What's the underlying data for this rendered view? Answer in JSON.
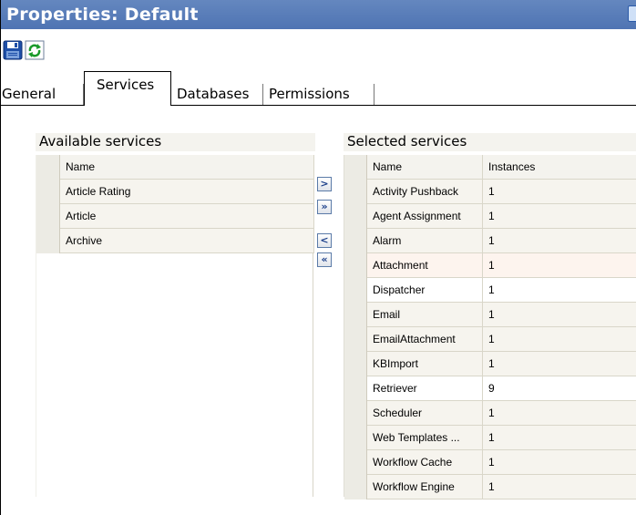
{
  "window": {
    "title": "Properties: Default"
  },
  "toolbar": {
    "save_icon": "save-disk-icon",
    "refresh_icon": "refresh-icon"
  },
  "tabs": [
    {
      "label": "General",
      "selected": false
    },
    {
      "label": "Services",
      "selected": true
    },
    {
      "label": "Databases",
      "selected": false
    },
    {
      "label": "Permissions",
      "selected": false
    }
  ],
  "available": {
    "label": "Available services",
    "columns": [
      "Name"
    ],
    "rows": [
      "Article Rating",
      "Article",
      "Archive"
    ]
  },
  "transfer": {
    "add": ">",
    "add_all": "»",
    "remove": "<",
    "remove_all": "«"
  },
  "selected": {
    "label": "Selected services",
    "columns": [
      "Name",
      "Instances"
    ],
    "rows": [
      {
        "name": "Activity Pushback",
        "instances": "1"
      },
      {
        "name": "Agent Assignment",
        "instances": "1"
      },
      {
        "name": "Alarm",
        "instances": "1"
      },
      {
        "name": "Attachment",
        "instances": "1"
      },
      {
        "name": "Dispatcher",
        "instances": "1"
      },
      {
        "name": "Email",
        "instances": "1"
      },
      {
        "name": "EmailAttachment",
        "instances": "1"
      },
      {
        "name": "KBImport",
        "instances": "1"
      },
      {
        "name": "Retriever",
        "instances": "9"
      },
      {
        "name": "Scheduler",
        "instances": "1"
      },
      {
        "name": "Web Templates ...",
        "instances": "1"
      },
      {
        "name": "Workflow Cache",
        "instances": "1"
      },
      {
        "name": "Workflow Engine",
        "instances": "1"
      }
    ]
  },
  "colors": {
    "titlebar": "#4f74b3",
    "grid_header": "#f4f3ee",
    "row_select": "#ecebe4"
  }
}
